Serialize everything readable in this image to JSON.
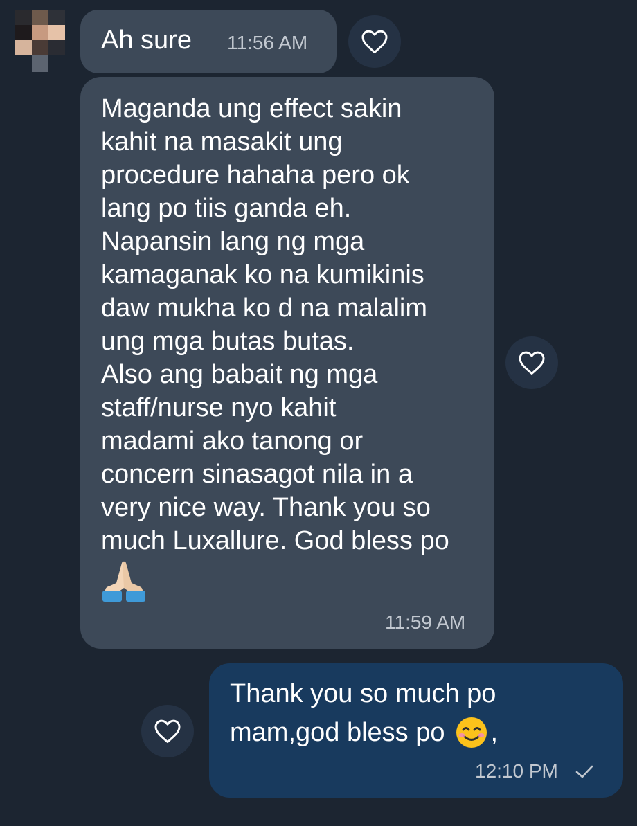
{
  "messages": [
    {
      "direction": "incoming",
      "text": "Ah sure",
      "time": "11:56 AM"
    },
    {
      "direction": "incoming",
      "text": "Maganda ung effect sakin\nkahit na masakit ung\nprocedure hahaha pero ok\nlang po tiis ganda eh.\nNapansin lang ng mga\nkamaganak ko na kumikinis\ndaw mukha ko d na malalim\nung mga butas butas.\nAlso ang babait ng mga\nstaff/nurse nyo kahit\nmadami ako tanong or\nconcern sinasagot nila in a\nvery nice way. Thank you so\nmuch Luxallure. God bless po",
      "emoji": "folded-hands",
      "time": "11:59 AM"
    },
    {
      "direction": "outgoing",
      "line1": "Thank you so much po",
      "line2": "mam,god bless po",
      "emoji": "smiling-face",
      "trailing": ",",
      "time": "12:10 PM",
      "status_icon": "check-icon"
    }
  ],
  "colors": {
    "background": "#1c2531",
    "incoming_bubble": "#3d4958",
    "outgoing_bubble": "#183a5e",
    "reaction_button": "#253244",
    "timestamp": "#c2c8d0"
  }
}
